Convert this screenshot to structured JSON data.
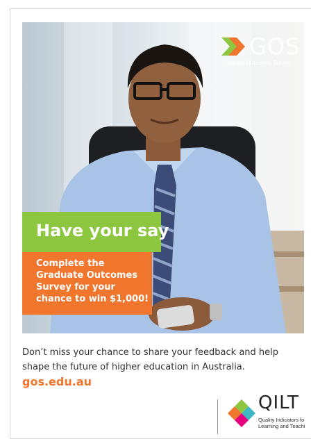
{
  "logo": {
    "wordmark": "GOS",
    "subtitle": "Graduate Outcomes Survey"
  },
  "headline": "Have your say",
  "promo_lines": [
    "Complete the",
    "Graduate Outcomes",
    "Survey for your",
    "chance to win $1,000!"
  ],
  "body_text": "Don’t miss your chance to share your feedback and help shape the future of higher education in Australia.",
  "url": "gos.edu.au",
  "footer_logo": {
    "wordmark": "QILT",
    "subtitle_line1": "Quality Indicators fo",
    "subtitle_line2": "Learning and Teachi"
  },
  "colors": {
    "green": "#8dc63f",
    "orange": "#f0752d",
    "text": "#333333"
  }
}
